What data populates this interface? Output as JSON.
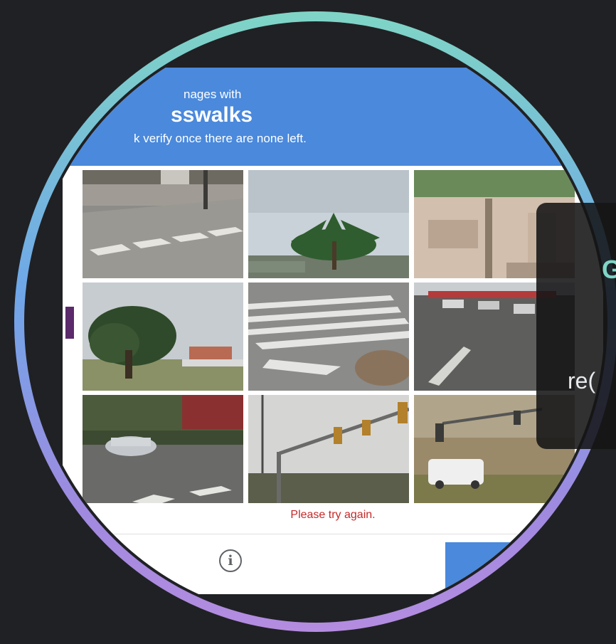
{
  "captcha": {
    "header_line1": "nages with",
    "header_line2": "sswalks",
    "header_line3": "k verify once there are none left.",
    "retry_message": "Please try again.",
    "info_icon": "info-icon",
    "tiles": [
      {
        "scene": "street corner with crosswalk stripes"
      },
      {
        "scene": "palm tree against sky"
      },
      {
        "scene": "pink building wall"
      },
      {
        "scene": "large tree with cloudy sky"
      },
      {
        "scene": "crosswalk stripes on road"
      },
      {
        "scene": "wide road with parked cars"
      },
      {
        "scene": "silver car at intersection"
      },
      {
        "scene": "traffic lights on pole"
      },
      {
        "scene": "white van below traffic light"
      }
    ]
  },
  "side_card": {
    "title": "G",
    "subtitle": "re("
  },
  "colors": {
    "header_blue": "#4a89dc",
    "error_red": "#c62828",
    "ring_top": "#7fd5c6",
    "ring_bottom": "#b48ce0"
  }
}
